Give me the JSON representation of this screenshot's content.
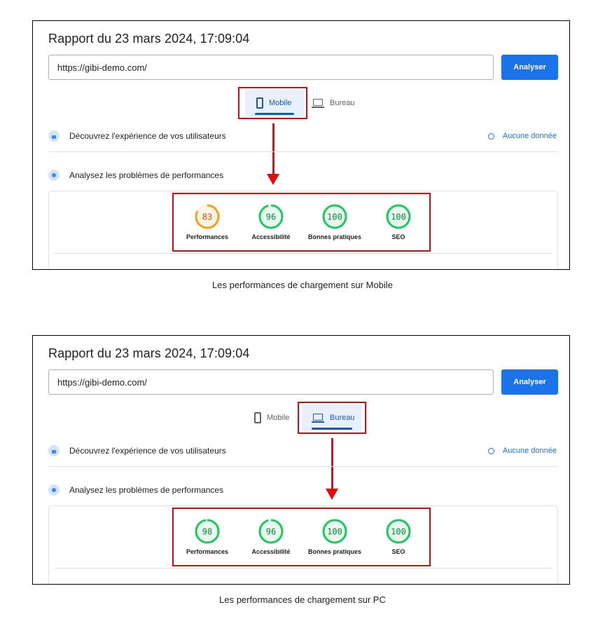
{
  "screenshots": [
    {
      "title": "Rapport du 23 mars 2024, 17:09:04",
      "url_value": "https://gibi-demo.com/",
      "analyze_label": "Analyser",
      "tabs": [
        {
          "label": "Mobile",
          "active": true,
          "icon": "phone-icon"
        },
        {
          "label": "Bureau",
          "active": false,
          "icon": "laptop-icon"
        }
      ],
      "section_users": "Découvrez l'expérience de vos utilisateurs",
      "no_data": "Aucune donnée",
      "section_perf": "Analysez les problèmes de performances",
      "scores": [
        {
          "label": "Performances",
          "value": 83,
          "display": "83",
          "color": "#f4a01b",
          "text_color": "#c9540e",
          "fill_color": "#fff4e5"
        },
        {
          "label": "Accessibilité",
          "value": 96,
          "display": "96",
          "color": "#1ec760",
          "text_color": "#0a8a37",
          "fill_color": "#e8f8ee"
        },
        {
          "label": "Bonnes pratiques",
          "value": 100,
          "display": "100",
          "color": "#1ec760",
          "text_color": "#0a8a37",
          "fill_color": "#e8f8ee"
        },
        {
          "label": "SEO",
          "value": 100,
          "display": "100",
          "color": "#1ec760",
          "text_color": "#0a8a37",
          "fill_color": "#e8f8ee"
        }
      ],
      "caption": "Les performances de chargement sur Mobile"
    },
    {
      "title": "Rapport du 23 mars 2024, 17:09:04",
      "url_value": "https://gibi-demo.com/",
      "analyze_label": "Analyser",
      "tabs": [
        {
          "label": "Mobile",
          "active": false,
          "icon": "phone-icon"
        },
        {
          "label": "Bureau",
          "active": true,
          "icon": "laptop-icon"
        }
      ],
      "section_users": "Découvrez l'expérience de vos utilisateurs",
      "no_data": "Aucune donnée",
      "section_perf": "Analysez les problèmes de performances",
      "scores": [
        {
          "label": "Performances",
          "value": 98,
          "display": "98",
          "color": "#1ec760",
          "text_color": "#0a8a37",
          "fill_color": "#e8f8ee"
        },
        {
          "label": "Accessibilité",
          "value": 96,
          "display": "96",
          "color": "#1ec760",
          "text_color": "#0a8a37",
          "fill_color": "#e8f8ee"
        },
        {
          "label": "Bonnes pratiques",
          "value": 100,
          "display": "100",
          "color": "#1ec760",
          "text_color": "#0a8a37",
          "fill_color": "#e8f8ee"
        },
        {
          "label": "SEO",
          "value": 100,
          "display": "100",
          "color": "#1ec760",
          "text_color": "#0a8a37",
          "fill_color": "#e8f8ee"
        }
      ],
      "caption": "Les performances de chargement sur PC"
    }
  ],
  "accent_color": "#1a73e8",
  "highlight_color": "#d10d0d"
}
